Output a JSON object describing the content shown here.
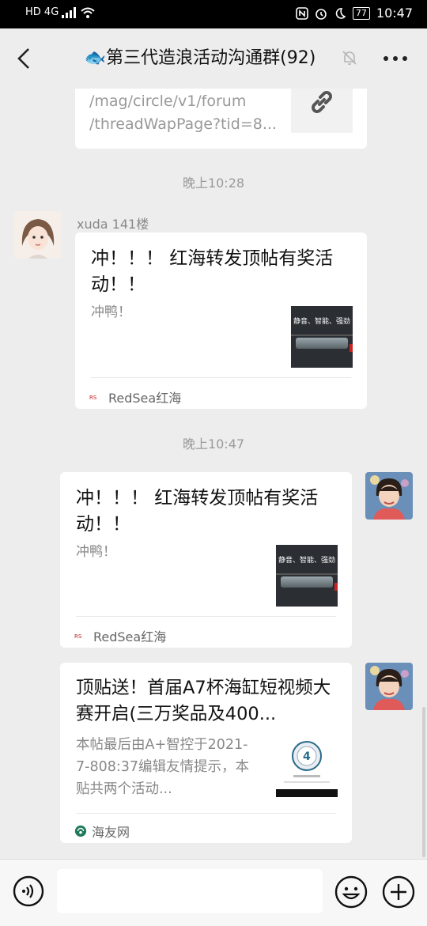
{
  "status_bar": {
    "network": "HD 4G",
    "battery": "77",
    "time": "10:47"
  },
  "header": {
    "title": "🐟第三代造浪活动沟通群(92)"
  },
  "messages": [
    {
      "link_lines": [
        "/mag/circle/v1/forum",
        "/threadWapPage?tid=8..."
      ]
    },
    {
      "time": "晚上10:28"
    },
    {
      "sender": "xuda 141楼",
      "title": "冲！！！ 红海转发顶帖有奖活动！！",
      "desc": "冲鸭！",
      "thumb_text": "静音、智能、强劲",
      "source": "RedSea红海"
    },
    {
      "time": "晚上10:47"
    },
    {
      "title": "冲！！！ 红海转发顶帖有奖活动！！",
      "desc": "冲鸭！",
      "thumb_text": "静音、智能、强劲",
      "source": "RedSea红海"
    },
    {
      "title": "顶贴送！首届A7杯海缸短视频大赛开启(三万奖品及400...",
      "desc": "本帖最后由A+智控于2021-7-808:37编辑友情提示，本贴共两个活动...",
      "source": "海友网"
    }
  ],
  "icons": {
    "back": "chevron-left-icon",
    "mute": "bell-off-icon",
    "more": "more-icon",
    "link": "link-icon",
    "voice": "voice-icon",
    "emoji": "emoji-icon",
    "plus": "plus-icon"
  }
}
